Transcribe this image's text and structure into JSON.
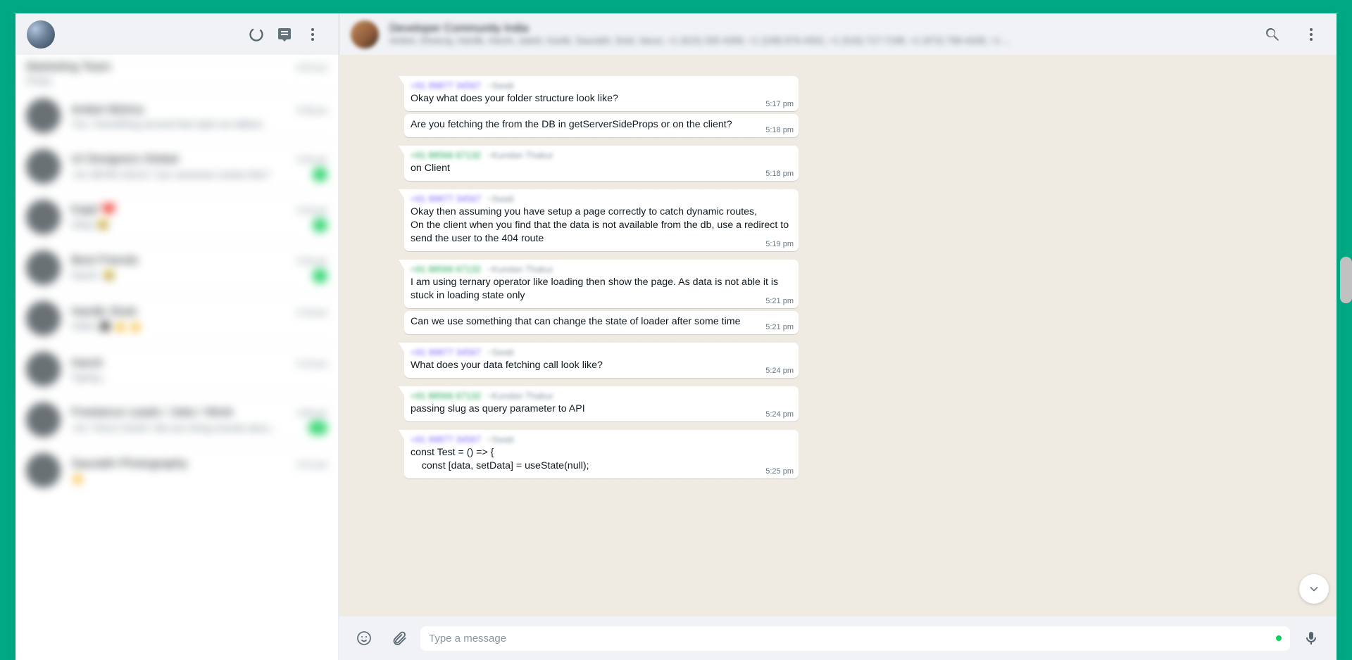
{
  "header": {
    "chat_title": "Developer Community India",
    "chat_subtitle": "Aniket, Dheeraj, Hardik, Harsh, Jatish, Kartik, Saurabh, Smit, Varun, +1 (615) 335-4308, +1 (248) 876-4302, +1 (516) 717-7198, +1 (972) 768-4328, +1 ..."
  },
  "sidebar": {
    "chats": [
      {
        "title": "Marketing Team",
        "preview": "Photo",
        "time": "6:02 pm",
        "unread": ""
      },
      {
        "title": "Aniket Mishra",
        "preview": "You: Something around that style we talked...",
        "time": "5:58 pm",
        "unread": ""
      },
      {
        "title": "UI Designers Global",
        "preview": "+91 98765 43210: Can someone review this?",
        "time": "5:40 pm",
        "unread": "1"
      },
      {
        "title": "Kajal ❤️",
        "preview": "Okay 😂",
        "time": "5:33 pm",
        "unread": "2"
      },
      {
        "title": "Best Friends",
        "preview": "Harsh: 😂",
        "time": "5:30 pm",
        "unread": "7"
      },
      {
        "title": "Hardik Shah",
        "preview": "Video 🎥 👍 👍",
        "time": "5:16 pm",
        "unread": ""
      },
      {
        "title": "Harsh",
        "preview": "Typing...",
        "time": "5:10 pm",
        "unread": ""
      },
      {
        "title": "Freelance Leads / Jobs / Work",
        "preview": "+91 70212 01020: We are hiring remote devs...",
        "time": "4:58 pm",
        "unread": "12"
      },
      {
        "title": "Saurabh Photography",
        "preview": "👍",
        "time": "4:21 pm",
        "unread": ""
      }
    ]
  },
  "input": {
    "placeholder": "Type a message"
  },
  "senders": {
    "a": {
      "phone": "+91 99877 34567",
      "name": "~Swati",
      "cls": "purple"
    },
    "b": {
      "phone": "+91 88566 67132",
      "name": "~Kundan Thakur",
      "cls": "green"
    }
  },
  "messages": [
    {
      "from": "a",
      "header": true,
      "text": "Okay what does your folder structure look like?",
      "time": "5:17 pm"
    },
    {
      "from": "a",
      "header": false,
      "text": "Are you fetching the from the DB in getServerSideProps or on the client?",
      "time": "5:18 pm"
    },
    {
      "from": "b",
      "header": true,
      "text": "on Client",
      "time": "5:18 pm"
    },
    {
      "from": "a",
      "header": true,
      "text": "Okay then assuming you have setup a page correctly to catch dynamic routes,\nOn the client when you find that the data is not available from the db, use a redirect to send the user to the 404 route",
      "time": "5:19 pm"
    },
    {
      "from": "b",
      "header": true,
      "text": "I am using ternary operator like loading then show the page. As data is not able it is stuck in loading state only",
      "time": "5:21 pm"
    },
    {
      "from": "b",
      "header": false,
      "text": "Can we use something that can change the state of loader after some time",
      "time": "5:21 pm"
    },
    {
      "from": "a",
      "header": true,
      "text": "What does your data fetching call look like?",
      "time": "5:24 pm"
    },
    {
      "from": "b",
      "header": true,
      "text": "passing slug as query parameter to API",
      "time": "5:24 pm"
    },
    {
      "from": "a",
      "header": true,
      "text": "const Test = () => {\n    const [data, setData] = useState(null);",
      "time": "5:25 pm"
    }
  ]
}
